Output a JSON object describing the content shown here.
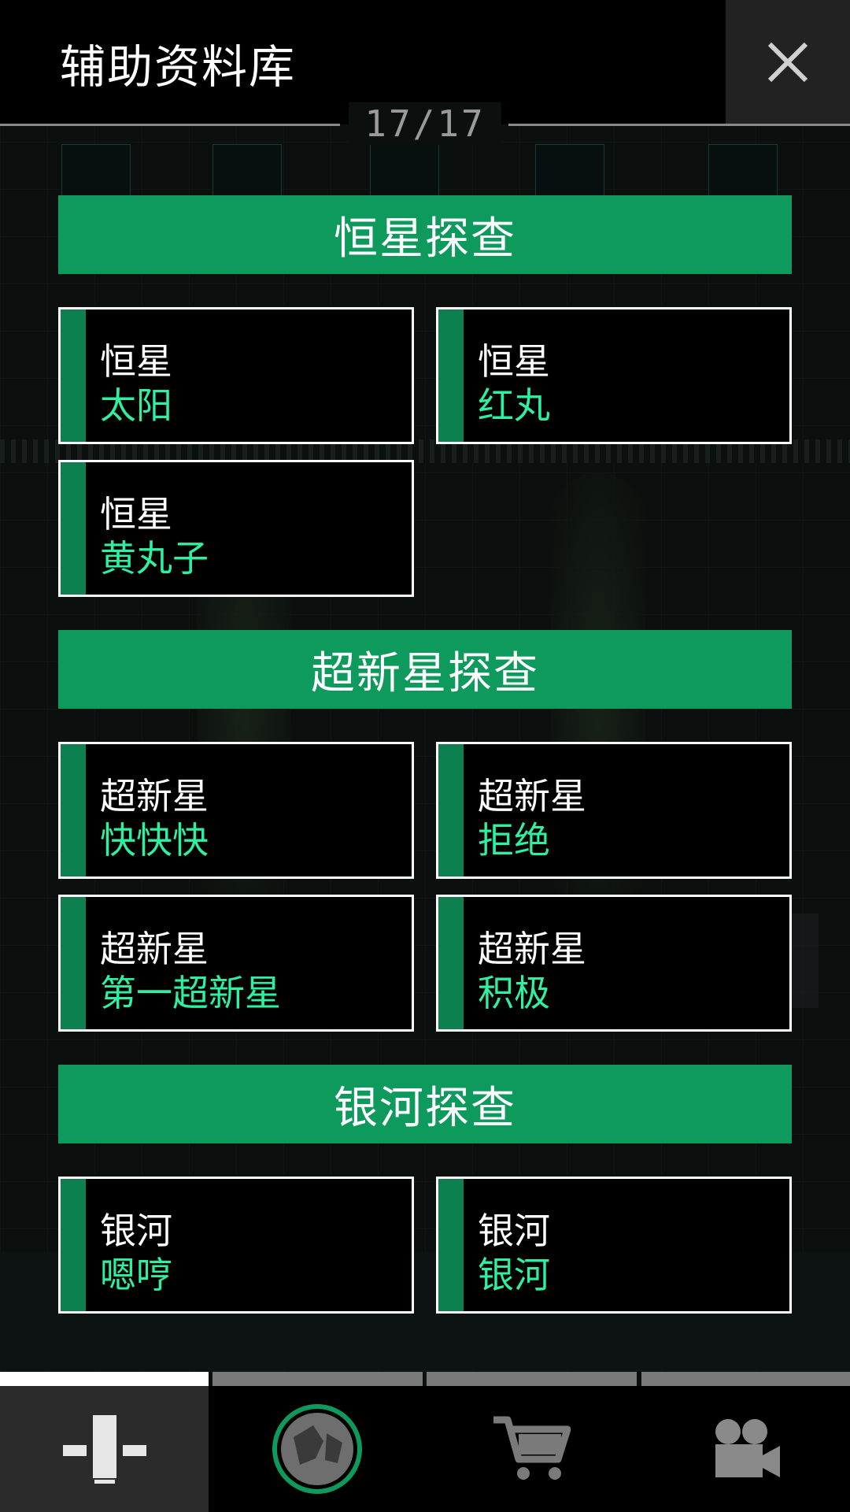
{
  "header": {
    "title": "辅助资料库",
    "page_indicator": "17/17"
  },
  "sections": [
    {
      "title": "恒星探查",
      "cards": [
        {
          "category": "恒星",
          "name": "太阳"
        },
        {
          "category": "恒星",
          "name": "红丸"
        },
        {
          "category": "恒星",
          "name": "黄丸子"
        }
      ]
    },
    {
      "title": "超新星探查",
      "cards": [
        {
          "category": "超新星",
          "name": "快快快"
        },
        {
          "category": "超新星",
          "name": "拒绝"
        },
        {
          "category": "超新星",
          "name": "第一超新星"
        },
        {
          "category": "超新星",
          "name": "积极"
        }
      ]
    },
    {
      "title": "银河探查",
      "cards": [
        {
          "category": "银河",
          "name": "嗯哼"
        },
        {
          "category": "银河",
          "name": "银河"
        }
      ]
    }
  ],
  "nav": {
    "tabs": [
      {
        "icon": "pillar-icon",
        "active": true
      },
      {
        "icon": "planet-icon",
        "active": false
      },
      {
        "icon": "cart-icon",
        "active": false
      },
      {
        "icon": "video-camera-icon",
        "active": false
      }
    ]
  },
  "colors": {
    "accent_green": "#0e9a5c",
    "card_bar_green": "#0e8050",
    "name_green": "#2ff0a0"
  }
}
